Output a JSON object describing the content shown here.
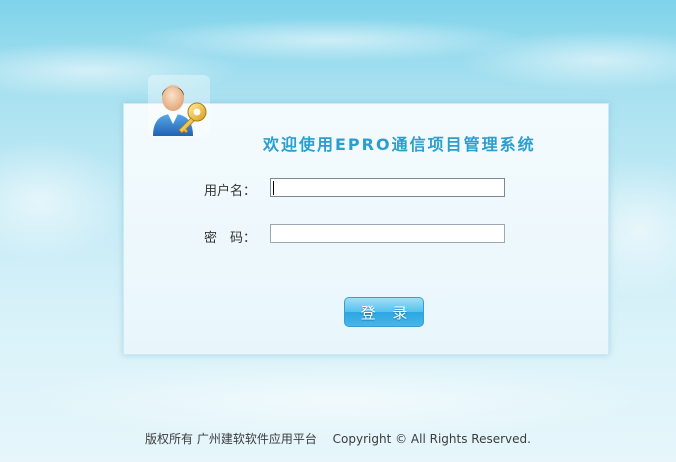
{
  "header": {
    "title": "欢迎使用EPRO通信项目管理系统",
    "icon": "user-key-icon"
  },
  "form": {
    "username_label": "用户名：",
    "username_value": "",
    "password_label": "密　码：",
    "password_value": "",
    "login_label": "登 录"
  },
  "footer": {
    "owner": "版权所有 广州建软软件应用平台",
    "copyright": "Copyright © All Rights Reserved."
  },
  "colors": {
    "accent": "#2a9fcf",
    "button": "#47b6ea"
  }
}
